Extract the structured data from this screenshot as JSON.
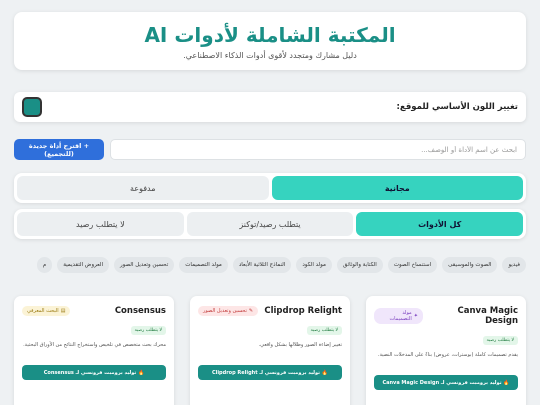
{
  "header": {
    "title": "المكتبة الشاملة لأدوات AI",
    "subtitle": "دليل مشارك ومتجدد لأقوى أدوات الذكاء الاصطناعي."
  },
  "color_picker": {
    "label": "تغيير اللون الأساسي للموقع:",
    "current_color": "#1a8f86"
  },
  "search": {
    "placeholder": "ابحث عن اسم الأداة أو الوصف...",
    "value": "",
    "suggest_label": "+ اقترح أداة جديدة (للتجميع)"
  },
  "price_filter": {
    "options": [
      "مجانية",
      "مدفوعة"
    ],
    "active": 0
  },
  "need_filter": {
    "options": [
      "كل الأدوات",
      "يتطلب رصيد/توكنز",
      "لا يتطلب رصيد"
    ],
    "active": 0
  },
  "categories": [
    "فيديو",
    "الصوت والموسيقى",
    "استنساخ الصوت",
    "الكتابة والوثائق",
    "مولد الكود",
    "النماذج الثلاثية الأبعاد",
    "مولد التصميمات",
    "تحسين وتعديل الصور",
    "العروض التقديمية",
    "م"
  ],
  "tools": [
    {
      "name": "Canva Magic Design",
      "category": "مولد التصميمات",
      "category_color": "#f0e6fb",
      "category_text_color": "#7a3fbf",
      "category_icon": "sparkle-icon",
      "free_badge": "لا يتطلب رصيد",
      "description": "يقدم تصميمات كاملة (بوسترات، عروض) بناءً على المدخلات النصية.",
      "button": "🔥 توليد برومبت فرونسي لـ Canva Magic Design"
    },
    {
      "name": "Clipdrop Relight",
      "category": "تحسين وتعديل الصور",
      "category_color": "#fde6e6",
      "category_text_color": "#c23a3a",
      "category_icon": "pencil-icon",
      "free_badge": "لا يتطلب رصيد",
      "description": "تغيير إضاءة الصور وظلالها بشكل واقعي.",
      "button": "🔥 توليد برومبت فرونسي لـ Clipdrop Relight"
    },
    {
      "name": "Consensus",
      "category": "البحث المعرفي",
      "category_color": "#fbf3d6",
      "category_text_color": "#9a7a10",
      "category_icon": "book-icon",
      "free_badge": "لا يتطلب رصيد",
      "description": "محرك بحث متخصص في تلخيص واستخراج النتائج من الأوراق البحثية.",
      "button": "🔥 توليد برومبت فرونسي لـ Consensus"
    }
  ]
}
